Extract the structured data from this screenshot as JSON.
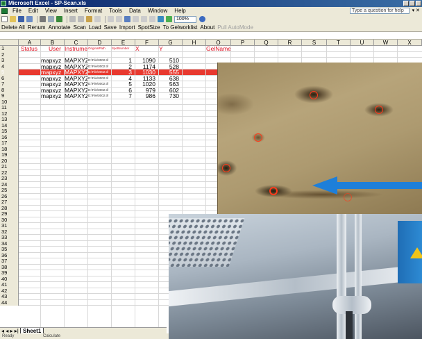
{
  "window": {
    "title": "Microsoft Excel - SP-Scan.xls"
  },
  "menu": {
    "items": [
      "File",
      "Edit",
      "View",
      "Insert",
      "Format",
      "Tools",
      "Data",
      "Window",
      "Help"
    ],
    "ask_placeholder": "Type a question for help"
  },
  "toolbar": {
    "zoom": "100%"
  },
  "addin_toolbar": {
    "buttons": [
      "Delete All",
      "Renum",
      "Annotate",
      "Scan",
      "Load",
      "Save",
      "Import",
      "SpotSize",
      "To Gelworklist",
      "About"
    ],
    "disabled_button": "Pull AutoMode"
  },
  "sheet": {
    "columns": [
      "A",
      "B",
      "C",
      "D",
      "E",
      "F",
      "G",
      "H",
      "O",
      "P",
      "Q",
      "R",
      "S",
      "T",
      "U",
      "W",
      "X"
    ],
    "header_row": {
      "status": "Status",
      "user": "User",
      "instrument": "Instrument",
      "original_path": "OriginalPath",
      "spot_number": "SpotNumber",
      "x": "X",
      "y": "Y",
      "gel_name": "GelName"
    },
    "data_rows": [
      {
        "row": "3",
        "status": "",
        "user": "mapxyz",
        "instrument": "MAPXYZ",
        "file": "D:\\File\\0002.tif",
        "spot": "1",
        "x": "1090",
        "y": "510"
      },
      {
        "row": "4",
        "status": "",
        "user": "mapxyz",
        "instrument": "MAPXYZ",
        "file": "D:\\File\\0002.tif",
        "spot": "2",
        "x": "1174",
        "y": "528"
      },
      {
        "row": "5",
        "status": "",
        "user": "mapxyz",
        "instrument": "MAPXYZ",
        "file": "D:\\File\\0002.tif",
        "spot": "3",
        "x": "1030",
        "y": "555",
        "selected": true
      },
      {
        "row": "6",
        "status": "",
        "user": "mapxyz",
        "instrument": "MAPXYZ",
        "file": "D:\\File\\0002.tif",
        "spot": "4",
        "x": "1133",
        "y": "638"
      },
      {
        "row": "7",
        "status": "",
        "user": "mapxyz",
        "instrument": "MAPXYZ",
        "file": "D:\\File\\0002.tif",
        "spot": "5",
        "x": "1020",
        "y": "563"
      },
      {
        "row": "8",
        "status": "",
        "user": "mapxyz",
        "instrument": "MAPXYZ",
        "file": "D:\\File\\0002.tif",
        "spot": "6",
        "x": "979",
        "y": "602"
      },
      {
        "row": "9",
        "status": "",
        "user": "mapxyz",
        "instrument": "MAPXYZ",
        "file": "D:\\File\\0002.tif",
        "spot": "7",
        "x": "986",
        "y": "730"
      }
    ],
    "sheet_tab": "Sheet1"
  },
  "statusbar": {
    "left": "Ready",
    "mid": "Calculate"
  },
  "colors": {
    "selection_red": "#e8392f",
    "spot_ring": "#ff3a1a",
    "arrow_blue": "#1e7fd9"
  }
}
